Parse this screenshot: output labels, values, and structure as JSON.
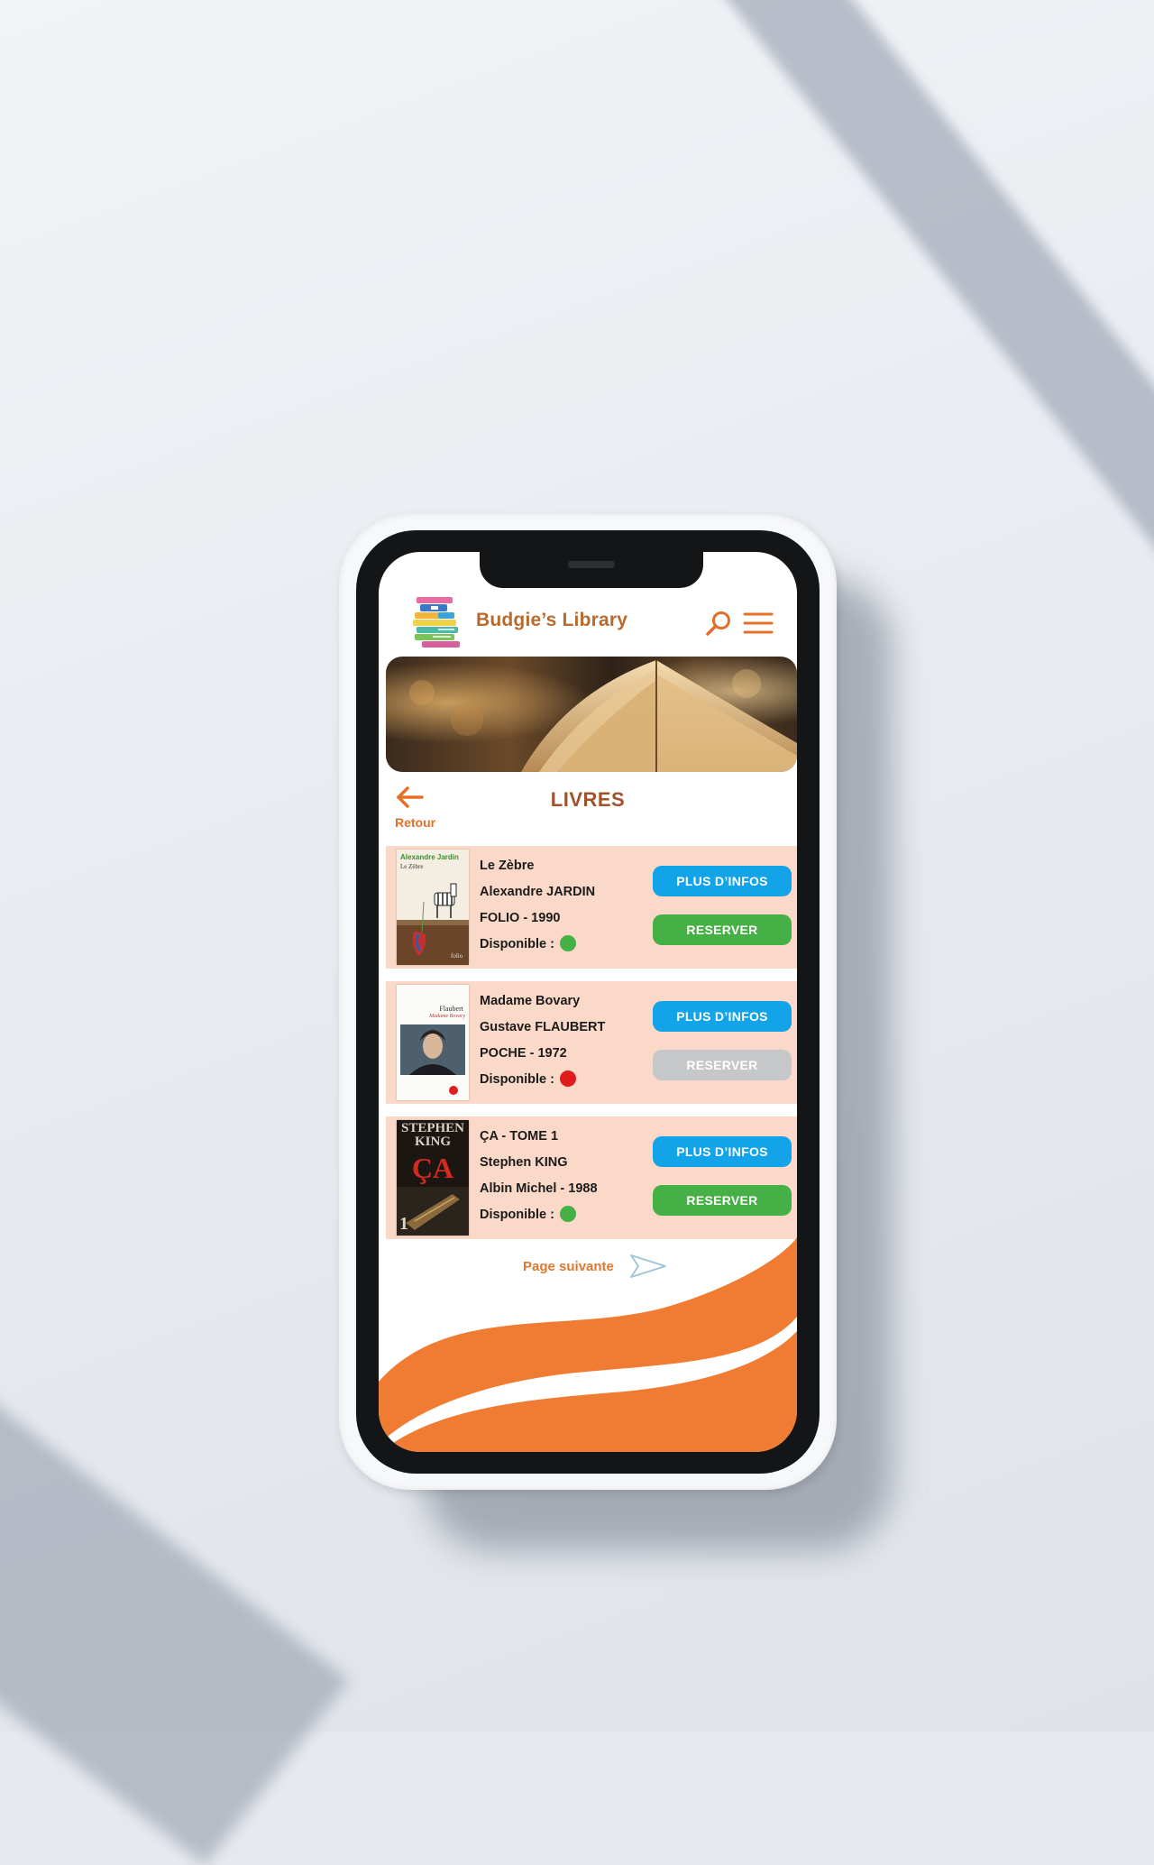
{
  "header": {
    "brand": "Budgie’s Library",
    "search_icon": "search-icon",
    "menu_icon": "hamburger-menu-icon"
  },
  "nav": {
    "back_label": "Retour",
    "page_title": "LIVRES"
  },
  "books": [
    {
      "title": "Le Zèbre",
      "author": "Alexandre JARDIN",
      "publisher_year": "FOLIO - 1990",
      "availability_label": "Disponible :",
      "available": true,
      "cover_author": "Alexandre Jardin",
      "cover_title": "Le Zèbre",
      "cover_publisher": "folio",
      "info_label": "PLUS D’INFOS",
      "reserve_label": "RESERVER"
    },
    {
      "title": "Madame Bovary",
      "author": "Gustave FLAUBERT",
      "publisher_year": "POCHE - 1972",
      "availability_label": "Disponible :",
      "available": false,
      "cover_author": "Flaubert",
      "cover_title": "Madame Bovary",
      "info_label": "PLUS D’INFOS",
      "reserve_label": "RESERVER"
    },
    {
      "title": "ÇA - TOME 1",
      "author": "Stephen KING",
      "publisher_year": "Albin Michel - 1988",
      "availability_label": "Disponible :",
      "available": true,
      "cover_author_line1": "STEPHEN",
      "cover_author_line2": "KING",
      "cover_title": "ÇA",
      "cover_tome": "1",
      "info_label": "PLUS D’INFOS",
      "reserve_label": "RESERVER"
    }
  ],
  "pagination": {
    "next_label": "Page suivante"
  },
  "colors": {
    "brand_orange": "#e46f28",
    "brand_brown": "#a0522d",
    "card_bg": "#fbd9c8",
    "info_blue": "#13a3e9",
    "reserve_green": "#45b045",
    "disabled_grey": "#c6c7c9",
    "available_green": "#45b045",
    "unavailable_red": "#e01b1b"
  }
}
